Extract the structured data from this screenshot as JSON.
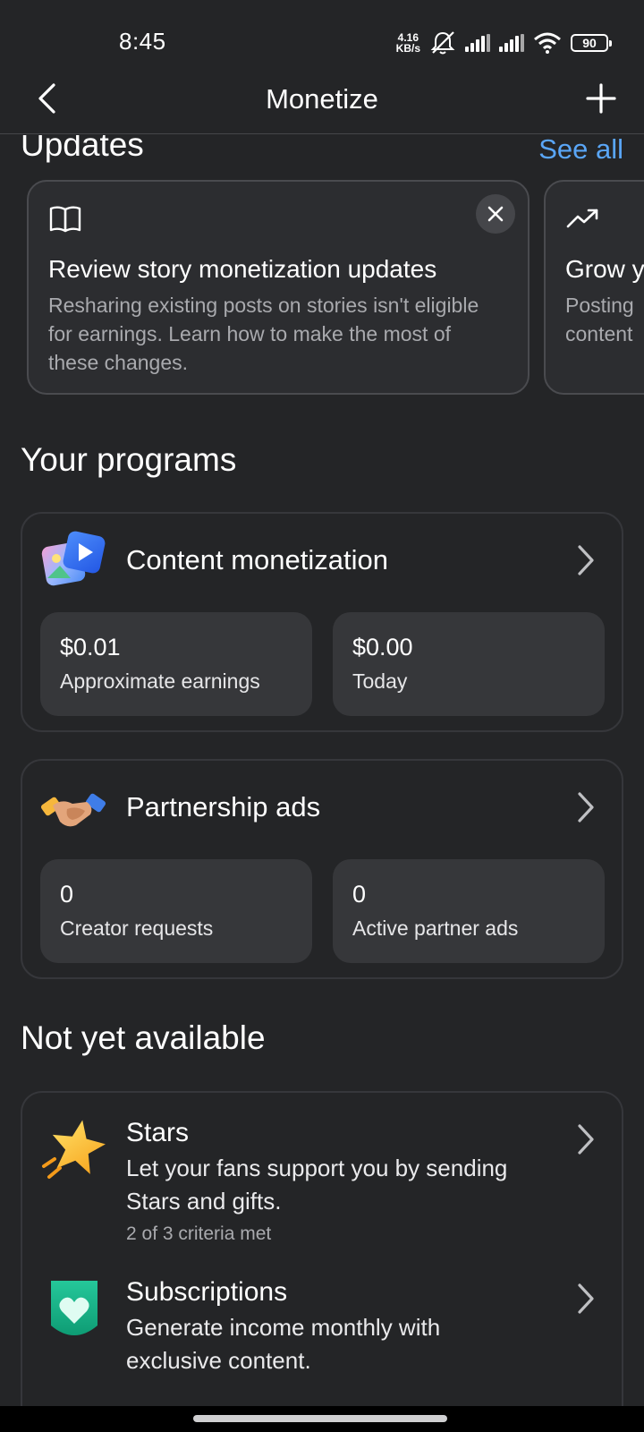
{
  "status_bar": {
    "time": "8:45",
    "speed_value": "4.16",
    "speed_unit": "KB/s",
    "battery": "90"
  },
  "header": {
    "title": "Monetize"
  },
  "updates": {
    "title": "Updates",
    "see_all": "See all",
    "cards": [
      {
        "icon": "book-icon",
        "title": "Review story monetization updates",
        "body": "Resharing existing posts on stories isn't eligible for earnings. Learn how to make the most of these changes."
      },
      {
        "icon": "trending-up-icon",
        "title": "Grow y",
        "body_line1": "Posting",
        "body_line2": "content"
      }
    ]
  },
  "programs": {
    "title": "Your programs",
    "items": [
      {
        "name": "Content monetization",
        "icon": "content-monetization-icon",
        "stats": [
          {
            "value": "$0.01",
            "label": "Approximate earnings"
          },
          {
            "value": "$0.00",
            "label": "Today"
          }
        ]
      },
      {
        "name": "Partnership ads",
        "icon": "handshake-icon",
        "stats": [
          {
            "value": "0",
            "label": "Creator requests"
          },
          {
            "value": "0",
            "label": "Active partner ads"
          }
        ]
      }
    ]
  },
  "not_available": {
    "title": "Not yet available",
    "items": [
      {
        "name": "Stars",
        "icon": "star-icon",
        "desc": "Let your fans support you by sending Stars and gifts.",
        "meta": "2 of 3 criteria met"
      },
      {
        "name": "Subscriptions",
        "icon": "subscription-heart-icon",
        "desc": "Generate income monthly with exclusive content."
      }
    ]
  },
  "colors": {
    "background": "#242527",
    "accent_link": "#5aa6f7",
    "card": "#2c2d30",
    "stat_tile": "#36373a"
  }
}
